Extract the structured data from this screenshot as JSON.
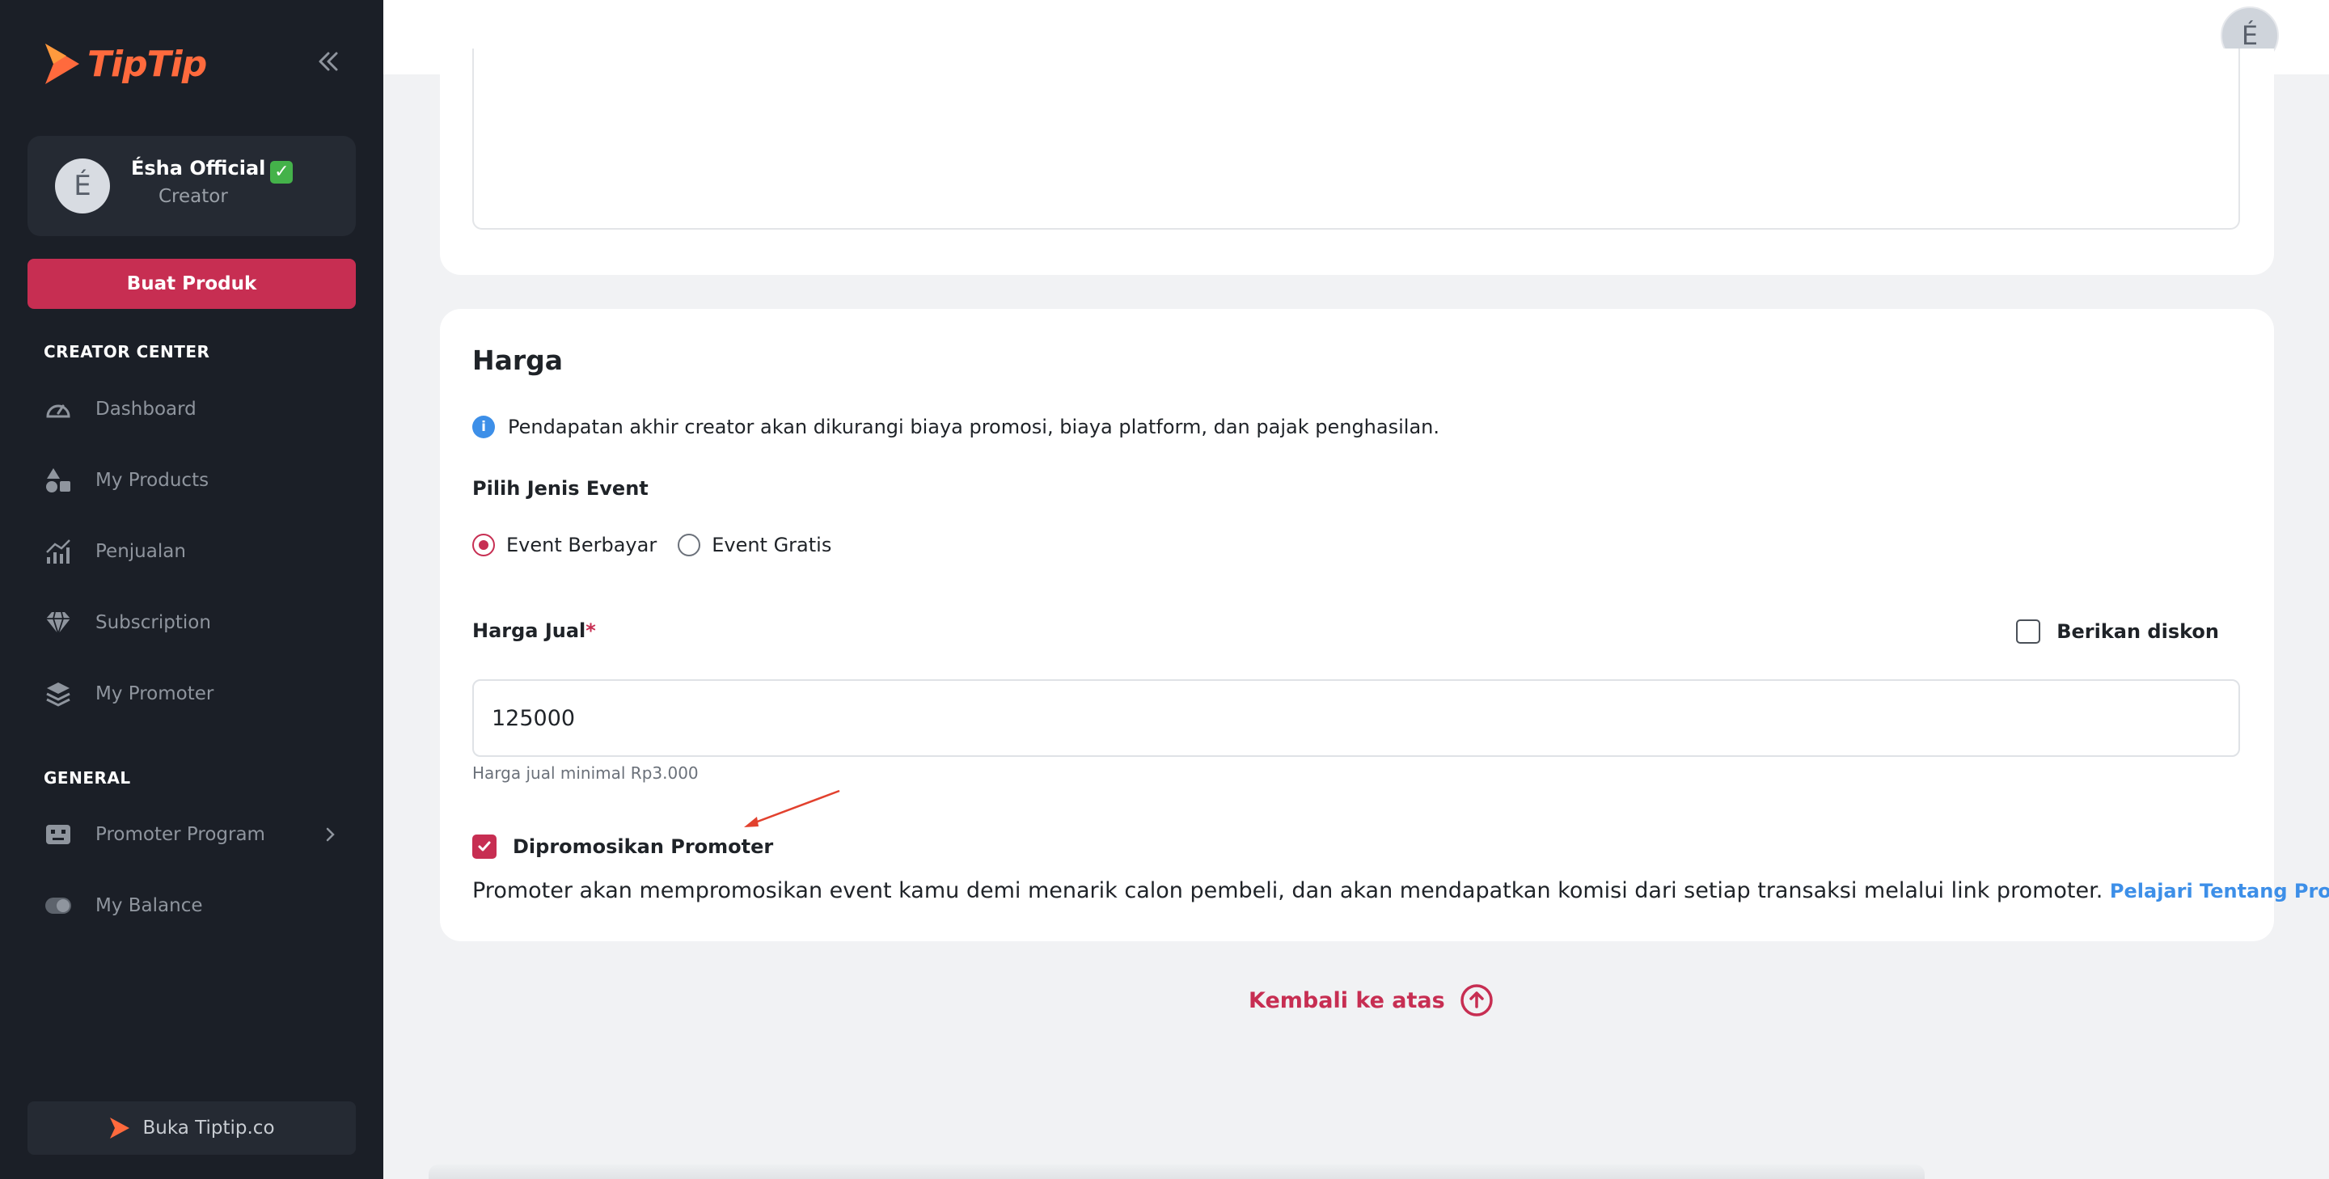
{
  "brand": {
    "name": "TipTip",
    "color": "#ff6a3d"
  },
  "sidebar": {
    "profile": {
      "initial": "É",
      "name": "Ésha Official",
      "verified_icon": "✓",
      "role": "Creator"
    },
    "create_button": "Buat Produk",
    "sections": [
      {
        "title": "CREATOR CENTER",
        "items": [
          {
            "label": "Dashboard",
            "icon": "gauge-icon"
          },
          {
            "label": "My Products",
            "icon": "shapes-icon"
          },
          {
            "label": "Penjualan",
            "icon": "chart-icon"
          },
          {
            "label": "Subscription",
            "icon": "diamond-icon"
          },
          {
            "label": "My Promoter",
            "icon": "layers-icon"
          }
        ]
      },
      {
        "title": "GENERAL",
        "items": [
          {
            "label": "Promoter Program",
            "icon": "robot-icon"
          },
          {
            "label": "My Balance",
            "icon": "toggle-icon"
          }
        ]
      }
    ],
    "open_site": "Buka Tiptip.co"
  },
  "topbar": {
    "avatar_initial": "É"
  },
  "price_section": {
    "title": "Harga",
    "info": "Pendapatan akhir creator akan dikurangi biaya promosi, biaya platform, dan pajak penghasilan.",
    "event_type_label": "Pilih Jenis Event",
    "event_options": [
      "Event Berbayar",
      "Event Gratis"
    ],
    "selected_event": "Event Berbayar",
    "price_label": "Harga Jual",
    "required_mark": "*",
    "discount_label": "Berikan diskon",
    "price_value": "125000",
    "price_hint": "Harga jual minimal Rp3.000",
    "promoter_label": "Dipromosikan Promoter",
    "promoter_checked": true,
    "promoter_desc": "Promoter akan mempromosikan event kamu demi menarik calon pembeli, dan akan mendapatkan komisi dari setiap transaksi melalui link promoter.",
    "promoter_link": "Pelajari Tentang Promoter"
  },
  "back_to_top": "Kembali ke atas",
  "colors": {
    "accent": "#c72e52",
    "link": "#3d8fe8",
    "sidebar": "#1b1f27"
  }
}
